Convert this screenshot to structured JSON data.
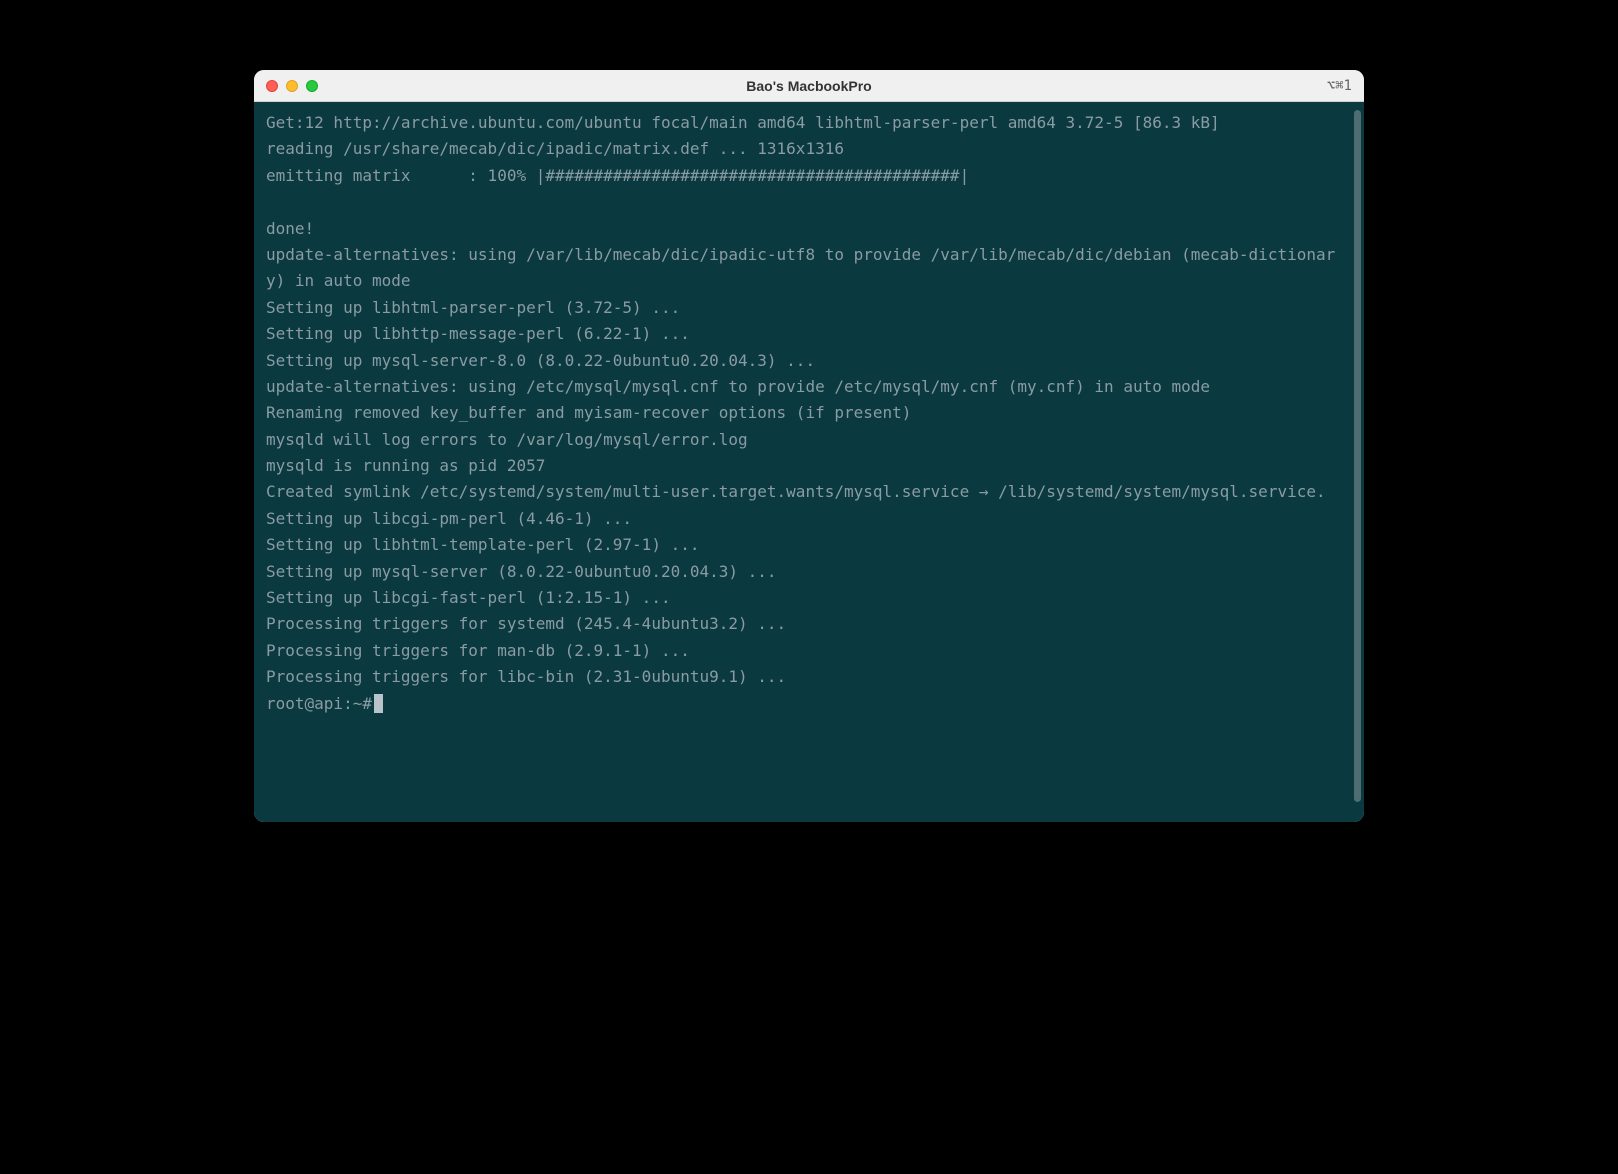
{
  "window": {
    "title": "Bao's MacbookPro",
    "shortcut": "⌥⌘1"
  },
  "terminal": {
    "lines": [
      "Get:12 http://archive.ubuntu.com/ubuntu focal/main amd64 libhtml-parser-perl amd64 3.72-5 [86.3 kB]",
      "reading /usr/share/mecab/dic/ipadic/matrix.def ... 1316x1316",
      "emitting matrix      : 100% |###########################################|",
      "",
      "done!",
      "update-alternatives: using /var/lib/mecab/dic/ipadic-utf8 to provide /var/lib/mecab/dic/debian (mecab-dictionary) in auto mode",
      "Setting up libhtml-parser-perl (3.72-5) ...",
      "Setting up libhttp-message-perl (6.22-1) ...",
      "Setting up mysql-server-8.0 (8.0.22-0ubuntu0.20.04.3) ...",
      "update-alternatives: using /etc/mysql/mysql.cnf to provide /etc/mysql/my.cnf (my.cnf) in auto mode",
      "Renaming removed key_buffer and myisam-recover options (if present)",
      "mysqld will log errors to /var/log/mysql/error.log",
      "mysqld is running as pid 2057",
      "Created symlink /etc/systemd/system/multi-user.target.wants/mysql.service → /lib/systemd/system/mysql.service.",
      "Setting up libcgi-pm-perl (4.46-1) ...",
      "Setting up libhtml-template-perl (2.97-1) ...",
      "Setting up mysql-server (8.0.22-0ubuntu0.20.04.3) ...",
      "Setting up libcgi-fast-perl (1:2.15-1) ...",
      "Processing triggers for systemd (245.4-4ubuntu3.2) ...",
      "Processing triggers for man-db (2.9.1-1) ...",
      "Processing triggers for libc-bin (2.31-0ubuntu9.1) ..."
    ],
    "prompt": "root@api:~# "
  }
}
